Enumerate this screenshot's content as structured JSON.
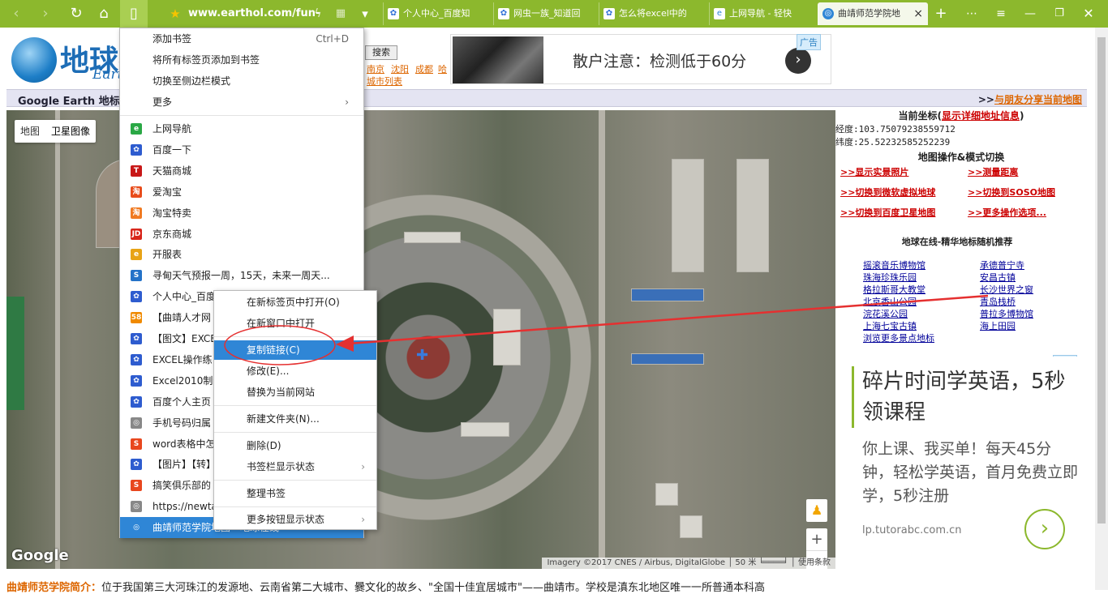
{
  "browser": {
    "address": "www.earthol.com/fun-",
    "tabs": [
      {
        "label": "个人中心_百度知",
        "icon": "baidu-paw-icon"
      },
      {
        "label": "网虫一族_知道回",
        "icon": "baidu-paw-icon"
      },
      {
        "label": "怎么将excel中的",
        "icon": "baidu-paw-icon"
      },
      {
        "label": "上网导航 - 轻快",
        "icon": "e-icon"
      },
      {
        "label": "曲靖师范学院地",
        "icon": "globe-icon"
      }
    ],
    "close_glyph": "×",
    "new_tab_glyph": "+"
  },
  "site": {
    "logo_text": "地球在",
    "logo_sub": "Eart",
    "search_label": "搜索",
    "city_links": [
      "南京",
      "沈阳",
      "成都",
      "哈"
    ],
    "city_list": "城市列表",
    "ad_badge": "广告",
    "ad1_text": "散户注意：检测低于60分",
    "ad1_go": "›",
    "bar_left": "Google Earth 地标在",
    "bar_right_prefix": ">>",
    "bar_right_link": "与朋友分享当前地图"
  },
  "map": {
    "type_map": "地图",
    "type_sat": "卫星图像",
    "google": "Google",
    "footer": "Imagery ©2017 CNES / Airbus, DigitalGlobe │ 50 米 ╘════╛ │ 使用条款",
    "zoom_in": "+",
    "zoom_out": "−",
    "pegman": "♟"
  },
  "sidebar": {
    "coord_title": "当前坐标(",
    "coord_link": "显示详细地址信息",
    "coord_close": ")",
    "lng": "经度:103.75079238559712",
    "lat": "纬度:25.52232585252239",
    "ops_title": "地图操作&模式切换",
    "ops": [
      ">>显示实景照片",
      ">>测量距离",
      ">>切换到微软虚拟地球",
      ">>切换到SOSO地图",
      ">>切换到百度卫星地图",
      ">>更多操作选项..."
    ],
    "rec_title": "地球在线-精华地标随机推荐",
    "rec_left": [
      "摇滚音乐博物馆",
      "珠海珍珠乐园",
      "格拉斯哥大教堂",
      "北京香山公园",
      "浣花溪公园",
      "上海七宝古镇",
      "浏览更多景点地标"
    ],
    "rec_right": [
      "承德普宁寺",
      "安昌古镇",
      "长沙世界之窗",
      "青岛栈桥",
      "普拉多博物馆",
      "海上田园"
    ]
  },
  "ad2": {
    "badge": "广告",
    "headline": "碎片时间学英语，5秒领课程",
    "body": "你上课、我买单！每天45分钟，轻松学英语，首月免费立即学，5秒注册",
    "url": "lp.tutorabc.com.cn",
    "go": "›"
  },
  "bottom": {
    "title": "曲靖师范学院简介：",
    "text": "位于我国第三大河珠江的发源地、云南省第二大城市、爨文化的故乡、\"全国十佳宜居城市\"——曲靖市。学校是滇东北地区唯一一所普通本科高"
  },
  "bookmarks_menu": {
    "top": [
      {
        "label": "添加书签",
        "shortcut": "Ctrl+D"
      },
      {
        "label": "将所有标签页添加到书签"
      },
      {
        "label": "切换至侧边栏模式"
      },
      {
        "label": "更多",
        "sub": "›"
      }
    ],
    "items": [
      {
        "label": "上网导航",
        "icon": "e-icon",
        "color": "#2aa845",
        "glyph": "e"
      },
      {
        "label": "百度一下",
        "icon": "baidu-paw-icon",
        "color": "#2e5ccf",
        "glyph": "✿"
      },
      {
        "label": "天猫商城",
        "icon": "tmall-icon",
        "color": "#c81818",
        "glyph": "T"
      },
      {
        "label": "爱淘宝",
        "icon": "taobao-icon",
        "color": "#e84c1b",
        "glyph": "淘"
      },
      {
        "label": "淘宝特卖",
        "icon": "taobao-icon",
        "color": "#f07a22",
        "glyph": "淘"
      },
      {
        "label": "京东商城",
        "icon": "jd-icon",
        "color": "#d8261b",
        "glyph": "JD"
      },
      {
        "label": "开服表",
        "icon": "e-icon",
        "color": "#e8a316",
        "glyph": "e"
      },
      {
        "label": "寻甸天气预报一周，15天，未来一周天...",
        "icon": "sogou-icon",
        "color": "#2472c8",
        "glyph": "S"
      },
      {
        "label": "个人中心_百度",
        "icon": "baidu-paw-icon",
        "color": "#2e5ccf",
        "glyph": "✿"
      },
      {
        "label": "【曲靖人才网",
        "icon": "58-icon",
        "color": "#f08a00",
        "glyph": "58"
      },
      {
        "label": "【图文】EXCE",
        "icon": "baidu-paw-icon",
        "color": "#2e5ccf",
        "glyph": "✿"
      },
      {
        "label": "EXCEL操作练",
        "icon": "baidu-paw-icon",
        "color": "#2e5ccf",
        "glyph": "✿"
      },
      {
        "label": "Excel2010制作",
        "icon": "baidu-paw-icon",
        "color": "#2e5ccf",
        "glyph": "✿"
      },
      {
        "label": "百度个人主页",
        "icon": "baidu-paw-icon",
        "color": "#2e5ccf",
        "glyph": "✿"
      },
      {
        "label": "手机号码归属",
        "icon": "globe-icon",
        "color": "#888888",
        "glyph": "◎"
      },
      {
        "label": "word表格中怎",
        "icon": "sogou-icon",
        "color": "#e8471e",
        "glyph": "S"
      },
      {
        "label": "【图片】【转】",
        "icon": "baidu-paw-icon",
        "color": "#2e5ccf",
        "glyph": "✿"
      },
      {
        "label": "搞笑俱乐部的",
        "icon": "sogou-icon",
        "color": "#e8471e",
        "glyph": "S"
      },
      {
        "label": "https://newta",
        "icon": "globe-icon",
        "color": "#888888",
        "glyph": "◎"
      },
      {
        "label": "曲靖师范学院地图 - 地球在线",
        "icon": "globe-icon",
        "color": "#2f86d6",
        "glyph": "◎"
      }
    ]
  },
  "context_menu": {
    "items": [
      "在新标签页中打开(O)",
      "在新窗口中打开",
      "复制链接(C)",
      "修改(E)...",
      "替换为当前网站",
      "新建文件夹(N)...",
      "删除(D)",
      "书签栏显示状态",
      "整理书签",
      "更多按钮显示状态"
    ],
    "sub_arrow": "›"
  }
}
